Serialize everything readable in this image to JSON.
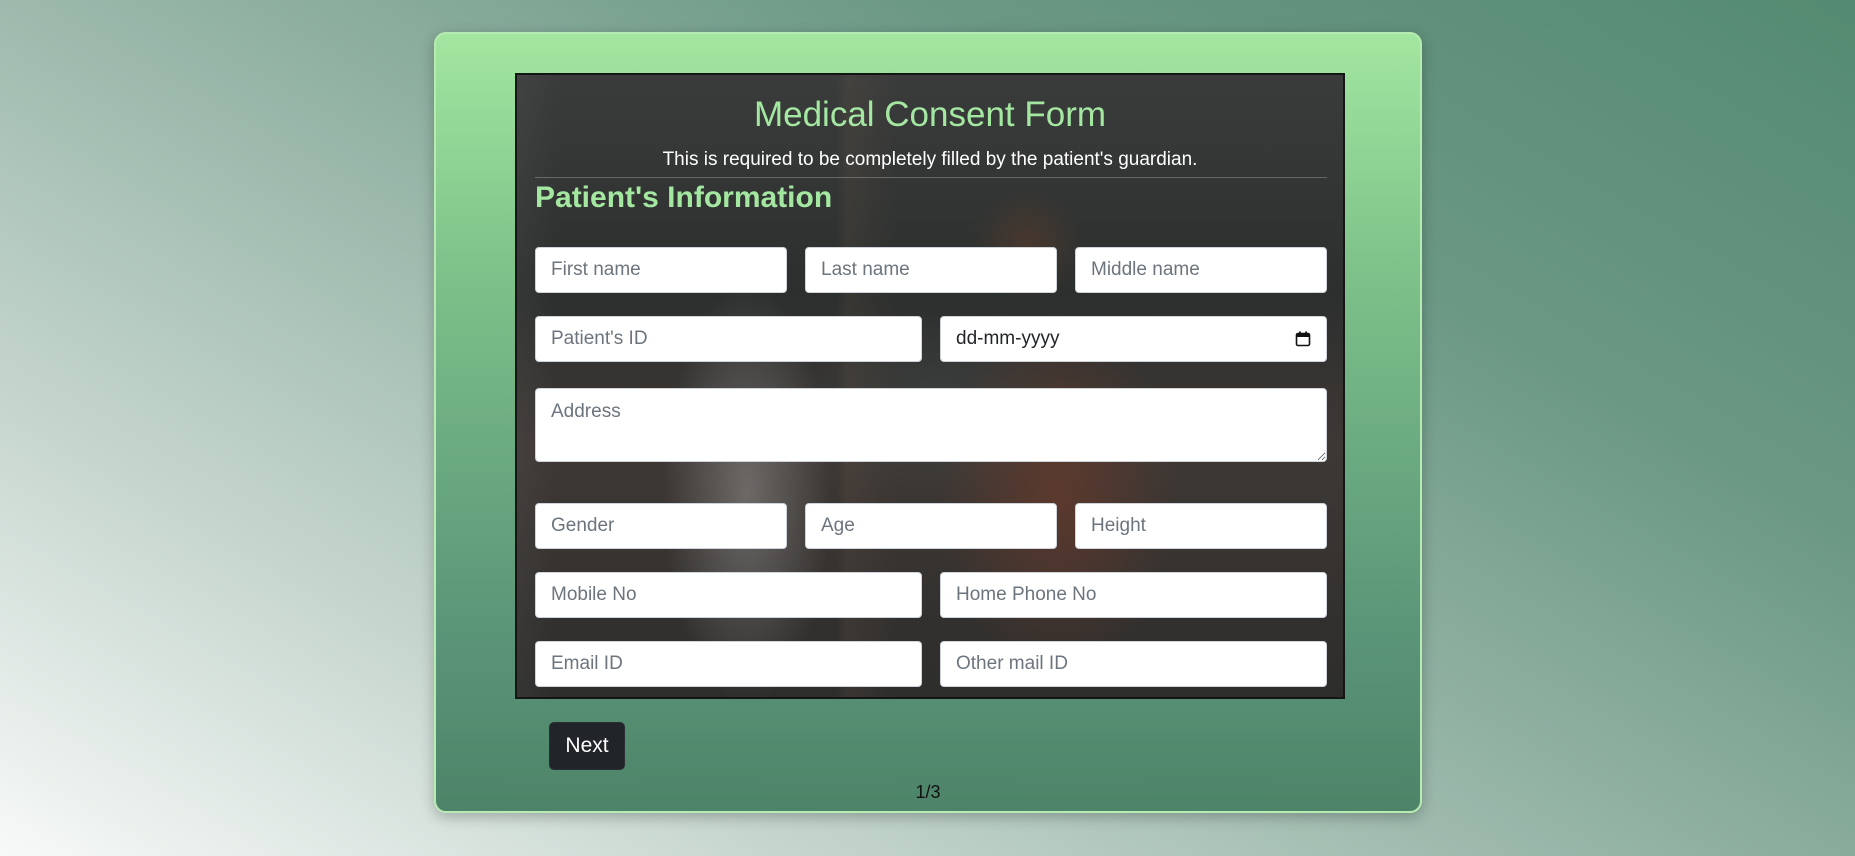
{
  "form": {
    "title": "Medical Consent Form",
    "subtitle": "This is required to be completely filled by the patient's guardian.",
    "section_heading": "Patient's Information",
    "fields": {
      "first_name": {
        "placeholder": "First name",
        "value": ""
      },
      "last_name": {
        "placeholder": "Last name",
        "value": ""
      },
      "middle_name": {
        "placeholder": "Middle name",
        "value": ""
      },
      "patient_id": {
        "placeholder": "Patient's ID",
        "value": ""
      },
      "date_of_birth": {
        "display": "dd-mm-yyyy"
      },
      "address": {
        "placeholder": "Address",
        "value": ""
      },
      "gender": {
        "placeholder": "Gender",
        "value": ""
      },
      "age": {
        "placeholder": "Age",
        "value": ""
      },
      "height": {
        "placeholder": "Height",
        "value": ""
      },
      "mobile_no": {
        "placeholder": "Mobile No",
        "value": ""
      },
      "home_phone_no": {
        "placeholder": "Home Phone No",
        "value": ""
      },
      "email_id": {
        "placeholder": "Email ID",
        "value": ""
      },
      "other_mail_id": {
        "placeholder": "Other mail ID",
        "value": ""
      }
    }
  },
  "navigation": {
    "next_label": "Next",
    "page_indicator": "1/3"
  },
  "icons": {
    "date_picker": "calendar-icon"
  },
  "colors": {
    "accent_green": "#a3e7a1",
    "button_dark": "#212529"
  }
}
